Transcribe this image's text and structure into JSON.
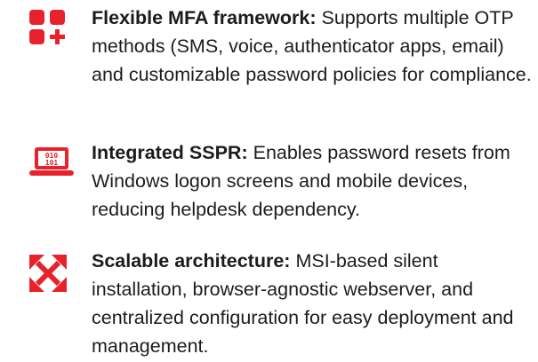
{
  "colors": {
    "accent": "#e8222c",
    "text": "#1c1c1c"
  },
  "features": [
    {
      "icon": "grid-plus-icon",
      "title": "Flexible MFA framework:",
      "description": " Supports multiple OTP methods (SMS, voice, authenticator apps, email) and customizable password policies for compliance."
    },
    {
      "icon": "binary-laptop-icon",
      "title": "Integrated SSPR:",
      "description": " Enables password resets from Windows logon screens and mobile devices, reducing helpdesk dependency."
    },
    {
      "icon": "expand-arrows-icon",
      "title": "Scalable architecture:",
      "description": " MSI-based silent installation, browser-agnostic webserver, and centralized configuration for easy deployment and management."
    }
  ]
}
